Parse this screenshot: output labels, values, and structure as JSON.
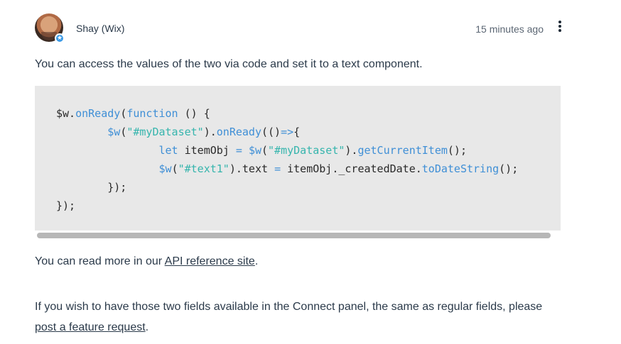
{
  "post": {
    "author": "Shay (Wix)",
    "time": "15 minutes ago",
    "badge_icon": "star-icon",
    "more_icon": "more-vertical-icon"
  },
  "paragraphs": {
    "p1": "You can access the values of the two via code and set it to a text component.",
    "p2_before": "You can read more in our ",
    "p2_link": "API reference site",
    "p2_after": ".",
    "p3_before": "If you wish to have those two fields available in the Connect panel, the same as regular fields, please ",
    "p3_link": "post a feature request",
    "p3_after": "."
  },
  "code": {
    "lines": [
      "$w.onReady(function () {",
      "        $w(\"#myDataset\").onReady(()=>{",
      "                let itemObj = $w(\"#myDataset\").getCurrentItem();",
      "                $w(\"#text1\").text = itemObj._createdDate.toDateString();",
      "        });",
      "});"
    ]
  },
  "colors": {
    "code_background": "#e8e8e8",
    "code_function": "#3f8fd6",
    "code_string": "#36b5ad",
    "text": "#2b3a4a",
    "badge": "#3b9ae6"
  }
}
